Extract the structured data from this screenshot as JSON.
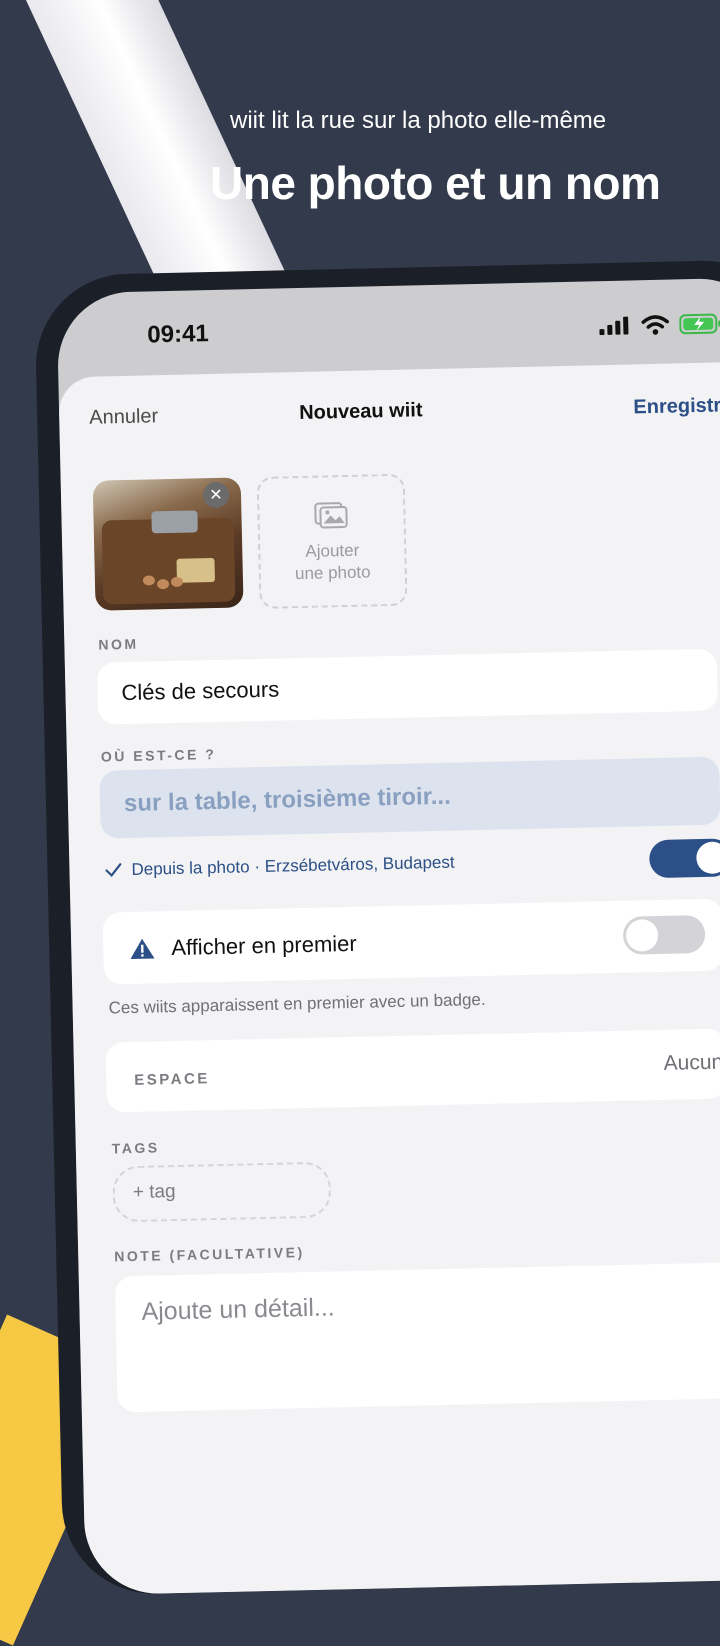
{
  "promo": {
    "caption": "wiit lit la rue sur la photo elle-même",
    "headline": "Une photo et un nom"
  },
  "status_bar": {
    "time": "09:41"
  },
  "nav": {
    "cancel": "Annuler",
    "title": "Nouveau wiit",
    "save": "Enregistrer"
  },
  "photos": {
    "add_line1": "Ajouter",
    "add_line2": "une photo",
    "remove_symbol": "✕"
  },
  "name": {
    "label": "NOM",
    "value": "Clés de secours"
  },
  "where": {
    "label": "OÙ EST-CE ?",
    "placeholder": "sur la table, troisième tiroir...",
    "from_photo": "Depuis la photo · Erzsébetváros, Budapest",
    "from_photo_enabled": true
  },
  "show_first": {
    "label": "Afficher en premier",
    "enabled": false,
    "helper": "Ces wiits apparaissent en premier avec un badge."
  },
  "space": {
    "label": "ESPACE",
    "value": "Aucun"
  },
  "tags": {
    "label": "TAGS",
    "add": "+ tag"
  },
  "note": {
    "label": "NOTE (FACULTATIVE)",
    "placeholder": "Ajoute un détail..."
  },
  "colors": {
    "background": "#333a4b",
    "accent": "#2b4f86",
    "yellow": "#f7c844",
    "warning": "#2b4f86"
  }
}
